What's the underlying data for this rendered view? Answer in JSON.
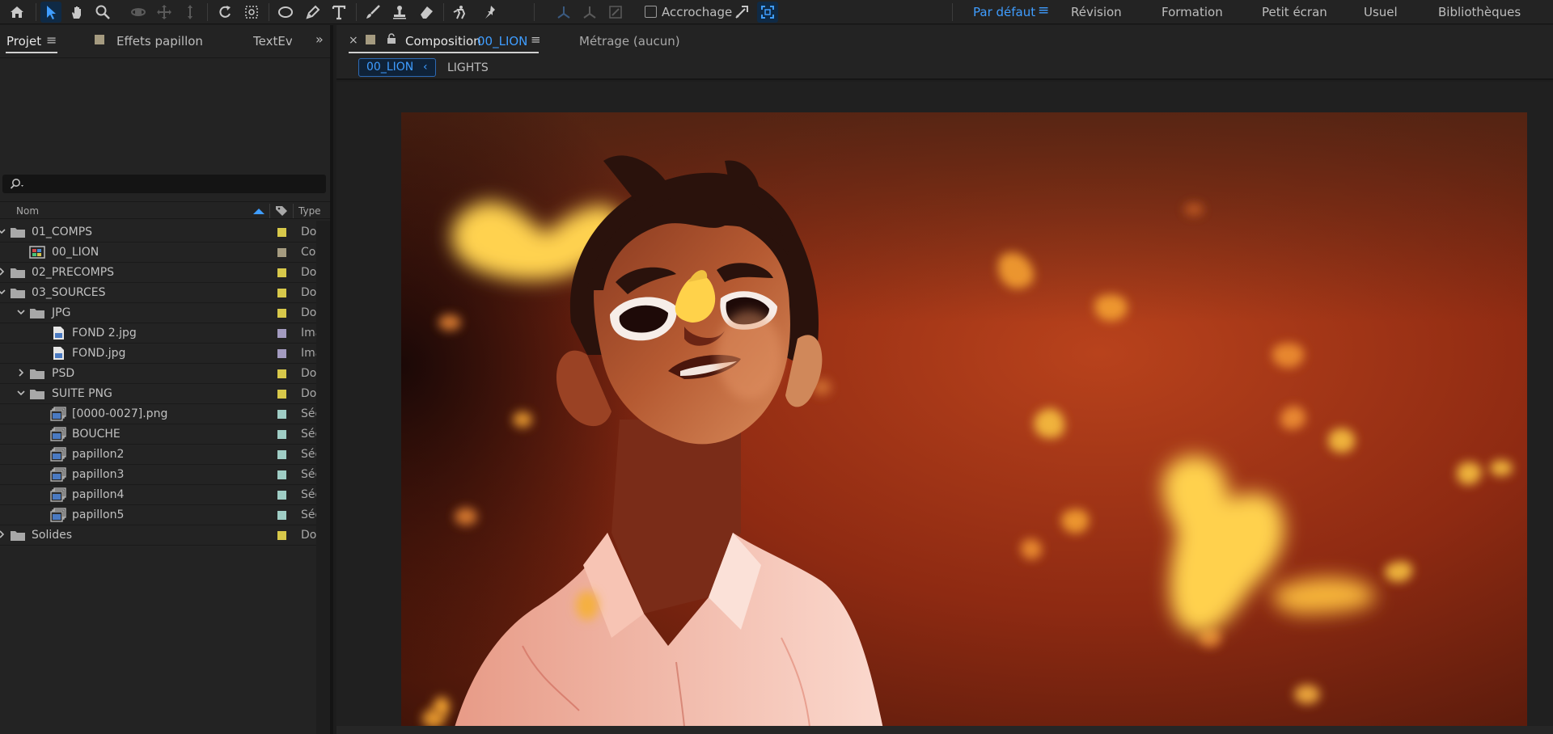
{
  "toolbar": {
    "tools": [
      {
        "icon": "home-icon"
      },
      {
        "icon": "selection-arrow-icon"
      },
      {
        "icon": "hand-icon"
      },
      {
        "icon": "zoom-icon"
      },
      {
        "icon": "orbit-camera-icon"
      },
      {
        "icon": "pan-camera-icon"
      },
      {
        "icon": "dolly-camera-icon"
      },
      {
        "icon": "rotate-icon"
      },
      {
        "icon": "pan-behind-icon"
      },
      {
        "icon": "ellipse-icon"
      },
      {
        "icon": "pen-icon"
      },
      {
        "icon": "type-icon"
      },
      {
        "icon": "brush-icon"
      },
      {
        "icon": "clone-stamp-icon"
      },
      {
        "icon": "eraser-icon"
      },
      {
        "icon": "roto-brush-icon"
      },
      {
        "icon": "puppet-pin-icon"
      }
    ],
    "snapping_label": "Accrochage"
  },
  "workspaces": {
    "items": [
      "Par défaut",
      "Révision",
      "Formation",
      "Petit écran",
      "Usuel",
      "Bibliothèques"
    ],
    "active": "Par défaut"
  },
  "project_panel": {
    "tabs": [
      {
        "label": "Projet",
        "active": true
      },
      {
        "label": "Effets  papillon"
      },
      {
        "label": "TextEvo"
      }
    ],
    "columns": {
      "name": "Nom",
      "type": "Type"
    },
    "rows": [
      {
        "name": "01_COMPS",
        "kind": "folder",
        "depth": 0,
        "expanded": true,
        "label_color": "#d7c84a",
        "type": "Dossier"
      },
      {
        "name": "00_LION",
        "kind": "comp",
        "depth": 1,
        "label_color": "#a59b80",
        "type": "Composition"
      },
      {
        "name": "02_PRECOMPS",
        "kind": "folder",
        "depth": 0,
        "expanded": false,
        "label_color": "#d7c84a",
        "type": "Dossier"
      },
      {
        "name": "03_SOURCES",
        "kind": "folder",
        "depth": 0,
        "expanded": true,
        "label_color": "#d7c84a",
        "type": "Dossier"
      },
      {
        "name": "JPG",
        "kind": "folder",
        "depth": 1,
        "expanded": true,
        "label_color": "#d7c84a",
        "type": "Dossier"
      },
      {
        "name": "FOND 2.jpg",
        "kind": "image",
        "depth": 2,
        "label_color": "#a39bc0",
        "type": "Image"
      },
      {
        "name": "FOND.jpg",
        "kind": "image",
        "depth": 2,
        "label_color": "#a39bc0",
        "type": "Image"
      },
      {
        "name": "PSD",
        "kind": "folder",
        "depth": 1,
        "expanded": false,
        "label_color": "#d7c84a",
        "type": "Dossier"
      },
      {
        "name": "SUITE PNG",
        "kind": "folder",
        "depth": 1,
        "expanded": true,
        "label_color": "#d7c84a",
        "type": "Dossier"
      },
      {
        "name": "[0000-0027].png",
        "kind": "sequence",
        "depth": 2,
        "label_color": "#9fcdc5",
        "type": "Séquence"
      },
      {
        "name": "BOUCHE",
        "kind": "sequence",
        "depth": 2,
        "label_color": "#9fcdc5",
        "type": "Séquence"
      },
      {
        "name": "papillon2",
        "kind": "sequence",
        "depth": 2,
        "label_color": "#9fcdc5",
        "type": "Séquence"
      },
      {
        "name": "papillon3",
        "kind": "sequence",
        "depth": 2,
        "label_color": "#9fcdc5",
        "type": "Séquence"
      },
      {
        "name": "papillon4",
        "kind": "sequence",
        "depth": 2,
        "label_color": "#9fcdc5",
        "type": "Séquence"
      },
      {
        "name": "papillon5",
        "kind": "sequence",
        "depth": 2,
        "label_color": "#9fcdc5",
        "type": "Séquence"
      },
      {
        "name": "Solides",
        "kind": "folder",
        "depth": 0,
        "expanded": false,
        "label_color": "#d7c84a",
        "type": "Dossier"
      }
    ]
  },
  "composition_panel": {
    "tab_prefix": "Composition",
    "tab_comp_name": "00_LION",
    "footage_tab": "Métrage  (aucun)",
    "breadcrumbs": [
      "00_LION",
      "LIGHTS"
    ]
  },
  "viewer": {
    "content": "composition-preview-boy-with-butterflies"
  }
}
